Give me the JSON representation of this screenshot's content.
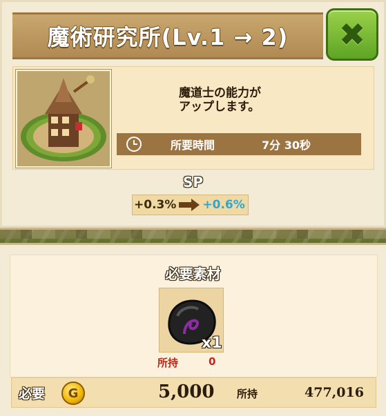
{
  "header": {
    "title": "魔術研究所(Lv.1 → 2)",
    "close_icon": "close-x-icon"
  },
  "info": {
    "description": "魔道士の能力が\nアップします。",
    "time_label": "所要時間",
    "time_value": "7分  30秒"
  },
  "sp": {
    "title": "SP",
    "old_value": "+0.3%",
    "new_value": "+0.6%"
  },
  "materials": {
    "title": "必要素材",
    "item_icon": "dark-orb-material-icon",
    "quantity": "x1",
    "owned_label": "所持",
    "owned_value": "0"
  },
  "cost": {
    "required_label": "必要",
    "coin_symbol": "G",
    "gold_required": "5,000",
    "owned_label": "所持",
    "owned_value": "477,016"
  },
  "colors": {
    "close_green": "#5ea424",
    "title_brown": "#b08a52",
    "new_value_blue": "#2aa8d8",
    "owned_red": "#c0281c"
  }
}
